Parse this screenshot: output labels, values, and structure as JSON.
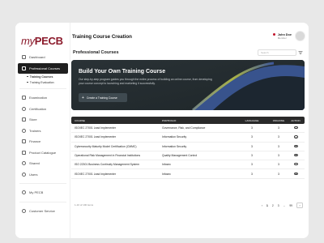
{
  "app": {
    "logo": {
      "prefix": "my",
      "brand": "PECB"
    },
    "page_title": "Training Course Creation"
  },
  "user": {
    "name": "John Doe",
    "role": "Member"
  },
  "sidebar": {
    "items": [
      {
        "label": "Dashboard",
        "icon": "dashboard-icon"
      },
      {
        "label": "Professional Courses",
        "icon": "book-icon",
        "active": true
      },
      {
        "label": "Examination",
        "icon": "exam-icon"
      },
      {
        "label": "Certification",
        "icon": "certificate-icon"
      },
      {
        "label": "Store",
        "icon": "store-icon"
      },
      {
        "label": "Trainers",
        "icon": "trainers-icon"
      },
      {
        "label": "Finance",
        "icon": "finance-icon"
      },
      {
        "label": "Product Catalogue",
        "icon": "catalogue-icon"
      },
      {
        "label": "Shared",
        "icon": "share-icon"
      },
      {
        "label": "Users",
        "icon": "users-icon"
      }
    ],
    "subitems": [
      {
        "label": "Training Courses",
        "active": true
      },
      {
        "label": "Training Evaluation"
      }
    ],
    "bottom": [
      {
        "label": "My PECB",
        "icon": "pecb-icon"
      },
      {
        "label": "Customer Service",
        "icon": "support-icon"
      }
    ]
  },
  "section": {
    "title": "Professional Courses",
    "search_placeholder": "Search"
  },
  "hero": {
    "title": "Build Your Own Training Course",
    "description": "Our step-by-step program guides you through the entire process of building an online course, from developing your course concept to launching and marketing it successfully.",
    "button": "Create a Training Course"
  },
  "table": {
    "headers": [
      "COURSE",
      "PORTFOLIO",
      "LANGUAGE",
      "ONGOING",
      "ACTION"
    ],
    "rows": [
      {
        "course": "ISO/IEC 27001 Lead Implementer",
        "portfolio": "Governance, Risk, and Compliance",
        "language": "3",
        "ongoing": "3"
      },
      {
        "course": "ISO/IEC 27001 Lead Implementer",
        "portfolio": "Information Security",
        "language": "3",
        "ongoing": "3"
      },
      {
        "course": "Cybersecurity Maturity Model Certification (CMMC)",
        "portfolio": "Information Security",
        "language": "3",
        "ongoing": "3"
      },
      {
        "course": "Operational Risk Management in Financial Institutions",
        "portfolio": "Quality Management Control",
        "language": "3",
        "ongoing": "3"
      },
      {
        "course": "ISO 22301 Business Continuity Management System",
        "portfolio": "Infosec",
        "language": "3",
        "ongoing": "3"
      },
      {
        "course": "ISO/IEC 27001 Lead Implementer",
        "portfolio": "Infosec",
        "language": "3",
        "ongoing": "3"
      }
    ]
  },
  "pager": {
    "info": "1-10 of 100 items",
    "pages": [
      "1",
      "2",
      "3",
      "...",
      "99"
    ],
    "current": "1"
  },
  "colors": {
    "brand": "#8b1a2b",
    "dark": "#1f1f1f",
    "hero": "#2a3236"
  }
}
